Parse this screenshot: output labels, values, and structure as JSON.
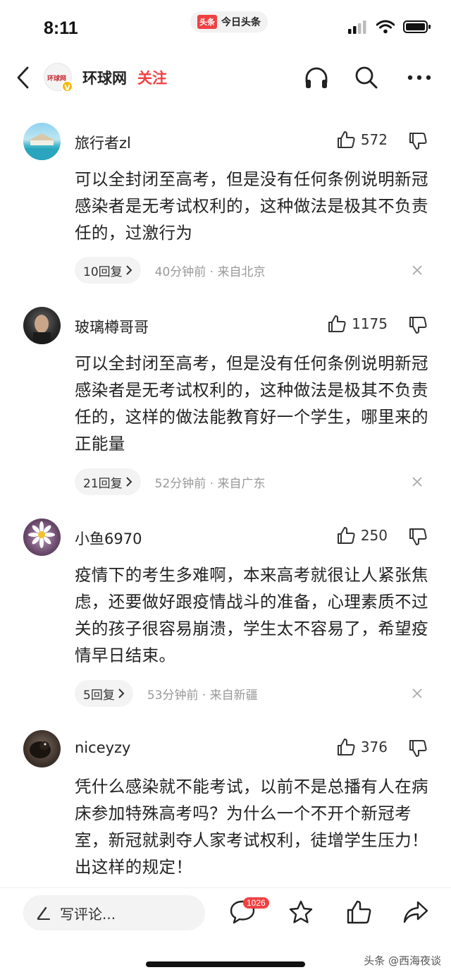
{
  "status_bar": {
    "time": "8:11",
    "app_logo": "头条",
    "app_name": "今日头条"
  },
  "nav": {
    "source_logo_text": "环球网",
    "source_name": "环球网",
    "follow_label": "关注",
    "verified_mark": "V"
  },
  "comments": [
    {
      "username": "旅行者zl",
      "likes": "572",
      "text": "可以全封闭至高考，但是没有任何条例说明新冠感染者是无考试权利的，这种做法是极其不负责任的，过激行为",
      "replies": "10回复",
      "time": "40分钟前 · 来自北京"
    },
    {
      "username": "玻璃樽哥哥",
      "likes": "1175",
      "text": "可以全封闭至高考，但是没有任何条例说明新冠感染者是无考试权利的，这种做法是极其不负责任的，这样的做法能教育好一个学生，哪里来的正能量",
      "replies": "21回复",
      "time": "52分钟前 · 来自广东"
    },
    {
      "username": "小鱼6970",
      "likes": "250",
      "text": "疫情下的考生多难啊，本来高考就很让人紧张焦虑，还要做好跟疫情战斗的准备，心理素质不过关的孩子很容易崩溃，学生太不容易了，希望疫情早日结束。",
      "replies": "5回复",
      "time": "53分钟前 · 来自新疆"
    },
    {
      "username": "niceyzy",
      "likes": "376",
      "text": "凭什么感染就不能考试，以前不是总播有人在病床参加特殊高考吗？为什么一个不开个新冠考室，新冠就剥夺人家考试权利，徒增学生压力！出这样的规定！"
    }
  ],
  "bottom_bar": {
    "input_placeholder": "写评论...",
    "comment_count": "1026",
    "watermark": "头条 @西海夜谈"
  },
  "icons": {
    "back": "chevron-left-icon",
    "listen": "headphones-icon",
    "search": "search-icon",
    "more": "more-dots-icon",
    "like": "thumbs-up-icon",
    "dislike": "thumbs-down-icon",
    "close": "close-icon",
    "comment": "comment-bubble-icon",
    "favorite": "star-icon",
    "share": "share-arrow-icon",
    "pen": "pen-icon"
  },
  "colors": {
    "accent": "#f04142",
    "text": "#222222",
    "muted": "#999999",
    "pill": "#f3f3f3"
  }
}
